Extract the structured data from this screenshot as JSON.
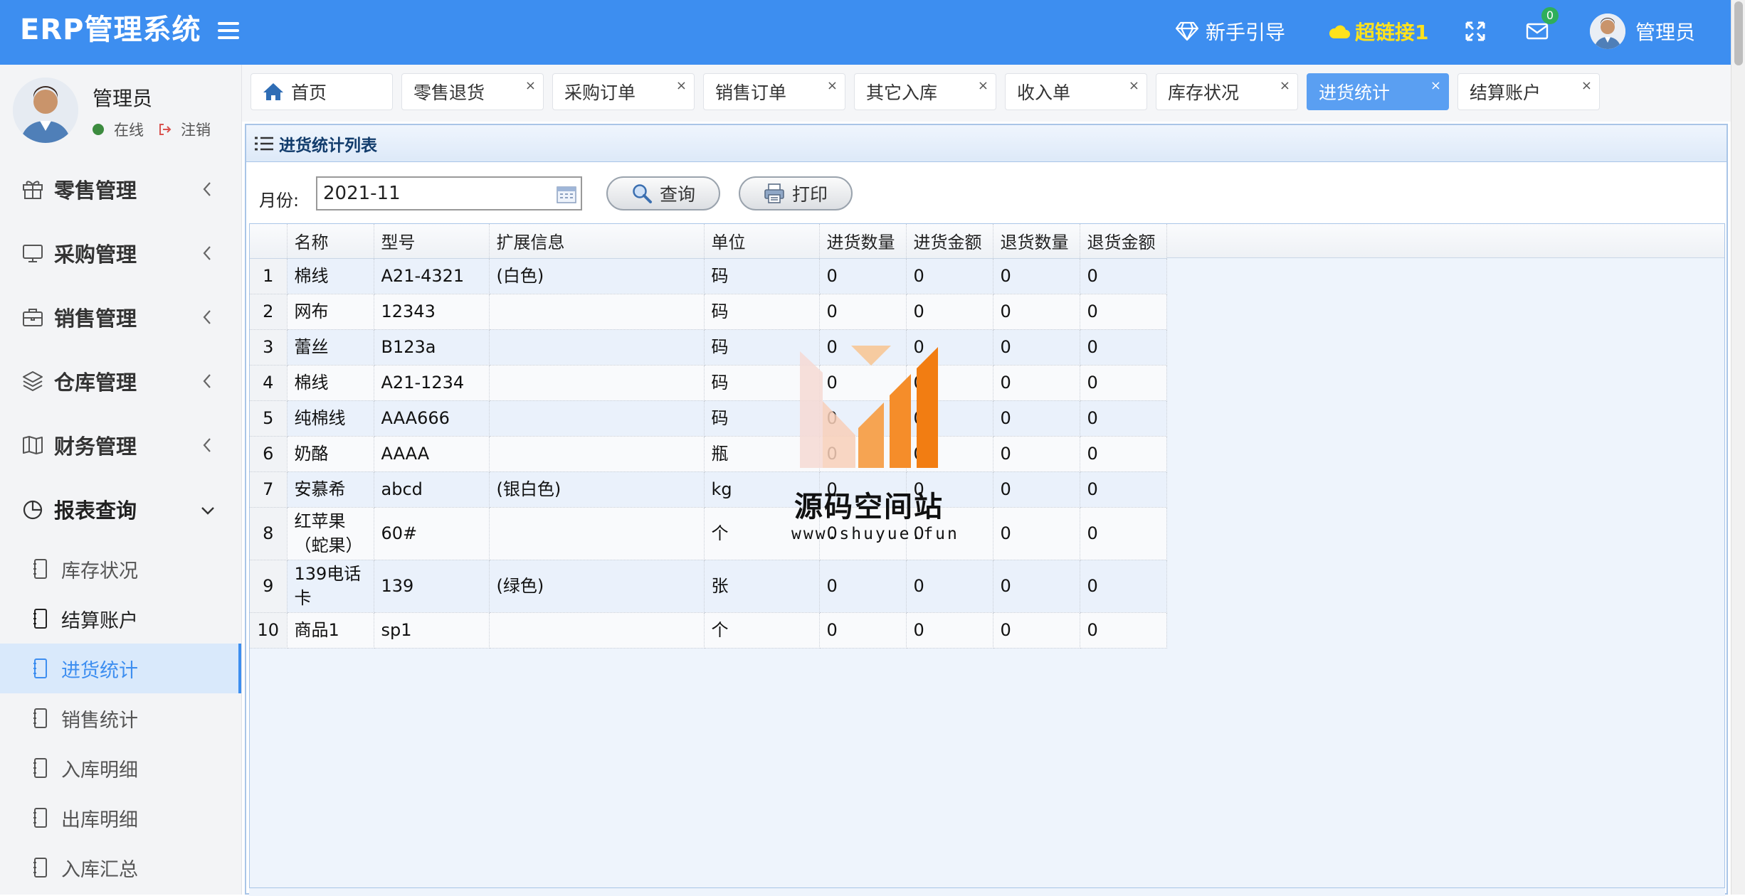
{
  "header": {
    "title": "ERP管理系统",
    "guide_label": "新手引导",
    "link_label": "超链接1",
    "mail_count": "0",
    "user_label": "管理员"
  },
  "sidebar": {
    "user": {
      "name": "管理员",
      "status": "在线",
      "logout": "注销"
    },
    "groups": [
      {
        "label": "零售管理",
        "icon": "gift-icon"
      },
      {
        "label": "采购管理",
        "icon": "monitor-icon"
      },
      {
        "label": "销售管理",
        "icon": "briefcase-icon"
      },
      {
        "label": "仓库管理",
        "icon": "layers-icon"
      },
      {
        "label": "财务管理",
        "icon": "book-icon"
      },
      {
        "label": "报表查询",
        "icon": "pie-icon"
      }
    ],
    "sub_items": [
      {
        "label": "库存状况"
      },
      {
        "label": "结算账户"
      },
      {
        "label": "进货统计",
        "active": true
      },
      {
        "label": "销售统计"
      },
      {
        "label": "入库明细"
      },
      {
        "label": "出库明细"
      },
      {
        "label": "入库汇总"
      }
    ]
  },
  "tabs": [
    {
      "label": "首页"
    },
    {
      "label": "零售退货"
    },
    {
      "label": "采购订单"
    },
    {
      "label": "销售订单"
    },
    {
      "label": "其它入库"
    },
    {
      "label": "收入单"
    },
    {
      "label": "库存状况"
    },
    {
      "label": "进货统计",
      "active": true
    },
    {
      "label": "结算账户"
    }
  ],
  "tab_close": "×",
  "panel": {
    "title": "进货统计列表",
    "month_label": "月份:",
    "month_value": "2021-11",
    "query_label": "查询",
    "print_label": "打印"
  },
  "table": {
    "columns": [
      "名称",
      "型号",
      "扩展信息",
      "单位",
      "进货数量",
      "进货金额",
      "退货数量",
      "退货金额"
    ],
    "rows": [
      [
        "1",
        "棉线",
        "A21-4321",
        "(白色)",
        "码",
        "0",
        "0",
        "0",
        "0"
      ],
      [
        "2",
        "网布",
        "12343",
        "",
        "码",
        "0",
        "0",
        "0",
        "0"
      ],
      [
        "3",
        "蕾丝",
        "B123a",
        "",
        "码",
        "0",
        "0",
        "0",
        "0"
      ],
      [
        "4",
        "棉线",
        "A21-1234",
        "",
        "码",
        "0",
        "0",
        "0",
        "0"
      ],
      [
        "5",
        "纯棉线",
        "AAA666",
        "",
        "码",
        "0",
        "0",
        "0",
        "0"
      ],
      [
        "6",
        "奶酪",
        "AAAA",
        "",
        "瓶",
        "0",
        "0",
        "0",
        "0"
      ],
      [
        "7",
        "安慕希",
        "abcd",
        "(银白色)",
        "kg",
        "0",
        "0",
        "0",
        "0"
      ],
      [
        "8",
        "红苹果（蛇果）",
        "60#",
        "",
        "个",
        "0",
        "0",
        "0",
        "0"
      ],
      [
        "9",
        "139电话卡",
        "139",
        "(绿色)",
        "张",
        "0",
        "0",
        "0",
        "0"
      ],
      [
        "10",
        "商品1",
        "sp1",
        "",
        "个",
        "0",
        "0",
        "0",
        "0"
      ]
    ]
  },
  "watermark": {
    "title": "源码空间站",
    "url": "www.shuyue.fun"
  },
  "colors": {
    "primary": "#3d8ef0",
    "link": "#ffe21c",
    "badge": "#2fae5a",
    "online": "#3c8b3f"
  }
}
